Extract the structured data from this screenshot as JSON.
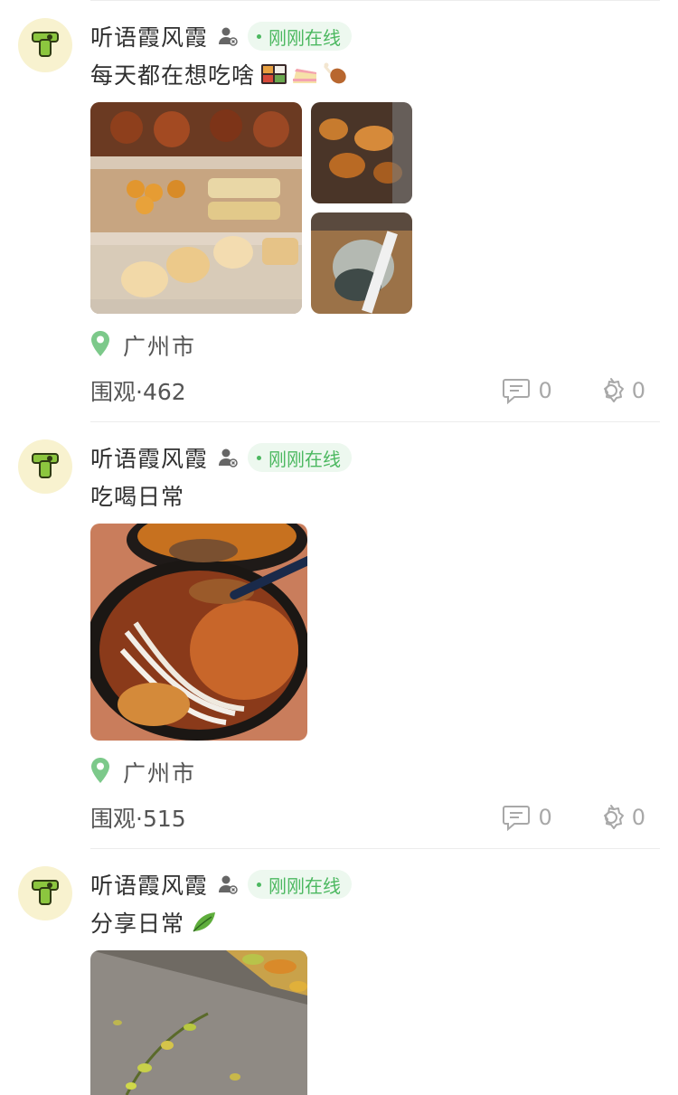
{
  "posts": [
    {
      "username": "听语霞风霞",
      "online_status": "刚刚在线",
      "text": "每天都在想吃啥",
      "emojis": [
        "bento-emoji",
        "cake-emoji",
        "drumstick-emoji"
      ],
      "location": "广州市",
      "views": "围观·462",
      "comment_count": "0",
      "like_count": "0"
    },
    {
      "username": "听语霞风霞",
      "online_status": "刚刚在线",
      "text": "吃喝日常",
      "emojis": [],
      "location": "广州市",
      "views": "围观·515",
      "comment_count": "0",
      "like_count": "0"
    },
    {
      "username": "听语霞风霞",
      "online_status": "刚刚在线",
      "text": "分享日常",
      "emojis": [
        "herb-emoji"
      ],
      "location": "",
      "views": "",
      "comment_count": "",
      "like_count": ""
    }
  ],
  "colors": {
    "online_green": "#4cb860",
    "online_bg": "#edf8ef",
    "location_pin": "#7cc98a",
    "divider": "#ececec",
    "icon_gray": "#a8a8a8"
  },
  "icons": {
    "gender": "person-gender-icon",
    "location": "location-pin-icon",
    "comment": "comment-bubble-icon",
    "like": "like-icon"
  }
}
